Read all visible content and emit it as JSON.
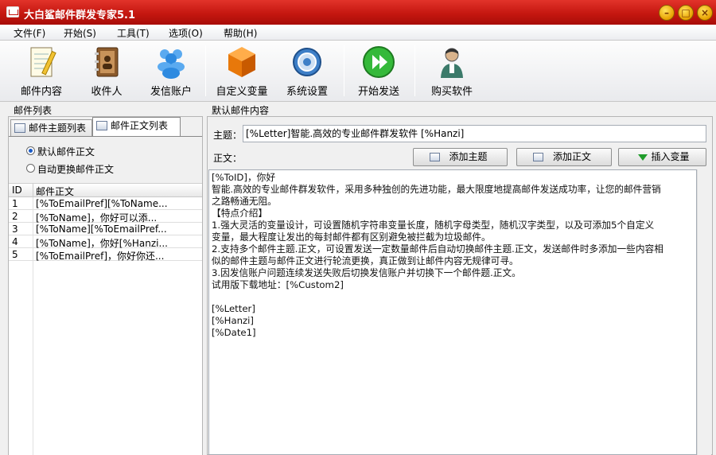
{
  "window": {
    "title": "大白鲨邮件群发专家5.1",
    "min": "–",
    "max": "□",
    "close": "×"
  },
  "menu": [
    "文件(F)",
    "开始(S)",
    "工具(T)",
    "选项(O)",
    "帮助(H)"
  ],
  "toolbar": [
    {
      "label": "邮件内容",
      "icon": "notepad-icon"
    },
    {
      "label": "收件人",
      "icon": "address-book-icon"
    },
    {
      "label": "发信账户",
      "icon": "users-icon"
    },
    {
      "label": "自定义变量",
      "icon": "orange-box-icon"
    },
    {
      "label": "系统设置",
      "icon": "gear-icon"
    },
    {
      "label": "开始发送",
      "icon": "play-icon"
    },
    {
      "label": "购买软件",
      "icon": "person-icon"
    }
  ],
  "left": {
    "group_label": "邮件列表",
    "tabs": [
      "邮件主题列表",
      "邮件正文列表"
    ],
    "active_tab": 1,
    "radios": [
      {
        "label": "默认邮件正文",
        "checked": true
      },
      {
        "label": "自动更换邮件正文",
        "checked": false
      }
    ],
    "columns": [
      "ID",
      "邮件正文"
    ],
    "rows": [
      {
        "id": "1",
        "text": "[%ToEmailPref][%ToName..."
      },
      {
        "id": "2",
        "text": "[%ToName]，你好可以添..."
      },
      {
        "id": "3",
        "text": "[%ToName][%ToEmailPref..."
      },
      {
        "id": "4",
        "text": "[%ToName]，你好[%Hanzi..."
      },
      {
        "id": "5",
        "text": "[%ToEmailPref]，你好你还..."
      }
    ]
  },
  "right": {
    "group_label": "默认邮件内容",
    "subject_label": "主题：",
    "subject_value": "[%Letter]智能.高效的专业邮件群发软件 [%Hanzi]",
    "body_label": "正文：",
    "buttons": [
      "添加主题",
      "添加正文",
      "插入变量"
    ],
    "body_lines": [
      "[%ToID]，你好",
      "智能.高效的专业邮件群发软件，采用多种独创的先进功能，最大限度地提高邮件发送成功率，让您的邮件营销",
      "之路畅通无阻。",
      "  【特点介绍】",
      "  1.强大灵活的变量设计，可设置随机字符串变量长度，随机字母类型，随机汉字类型，以及可添加5个自定义",
      "变量，最大程度让发出的每封邮件都有区别避免被拦截为垃圾邮件。",
      "2.支持多个邮件主题.正文，可设置发送一定数量邮件后自动切换邮件主题.正文，发送邮件时多添加一些内容相",
      "似的邮件主题与邮件正文进行轮流更换，真正做到让邮件内容无规律可寻。",
      "3.因发信账户问题连续发送失败后切换发信账户并切换下一个邮件题.正文。",
      "试用版下载地址：[%Custom2]",
      "",
      "[%Letter]",
      "[%Hanzi]",
      "[%Date1]"
    ]
  }
}
